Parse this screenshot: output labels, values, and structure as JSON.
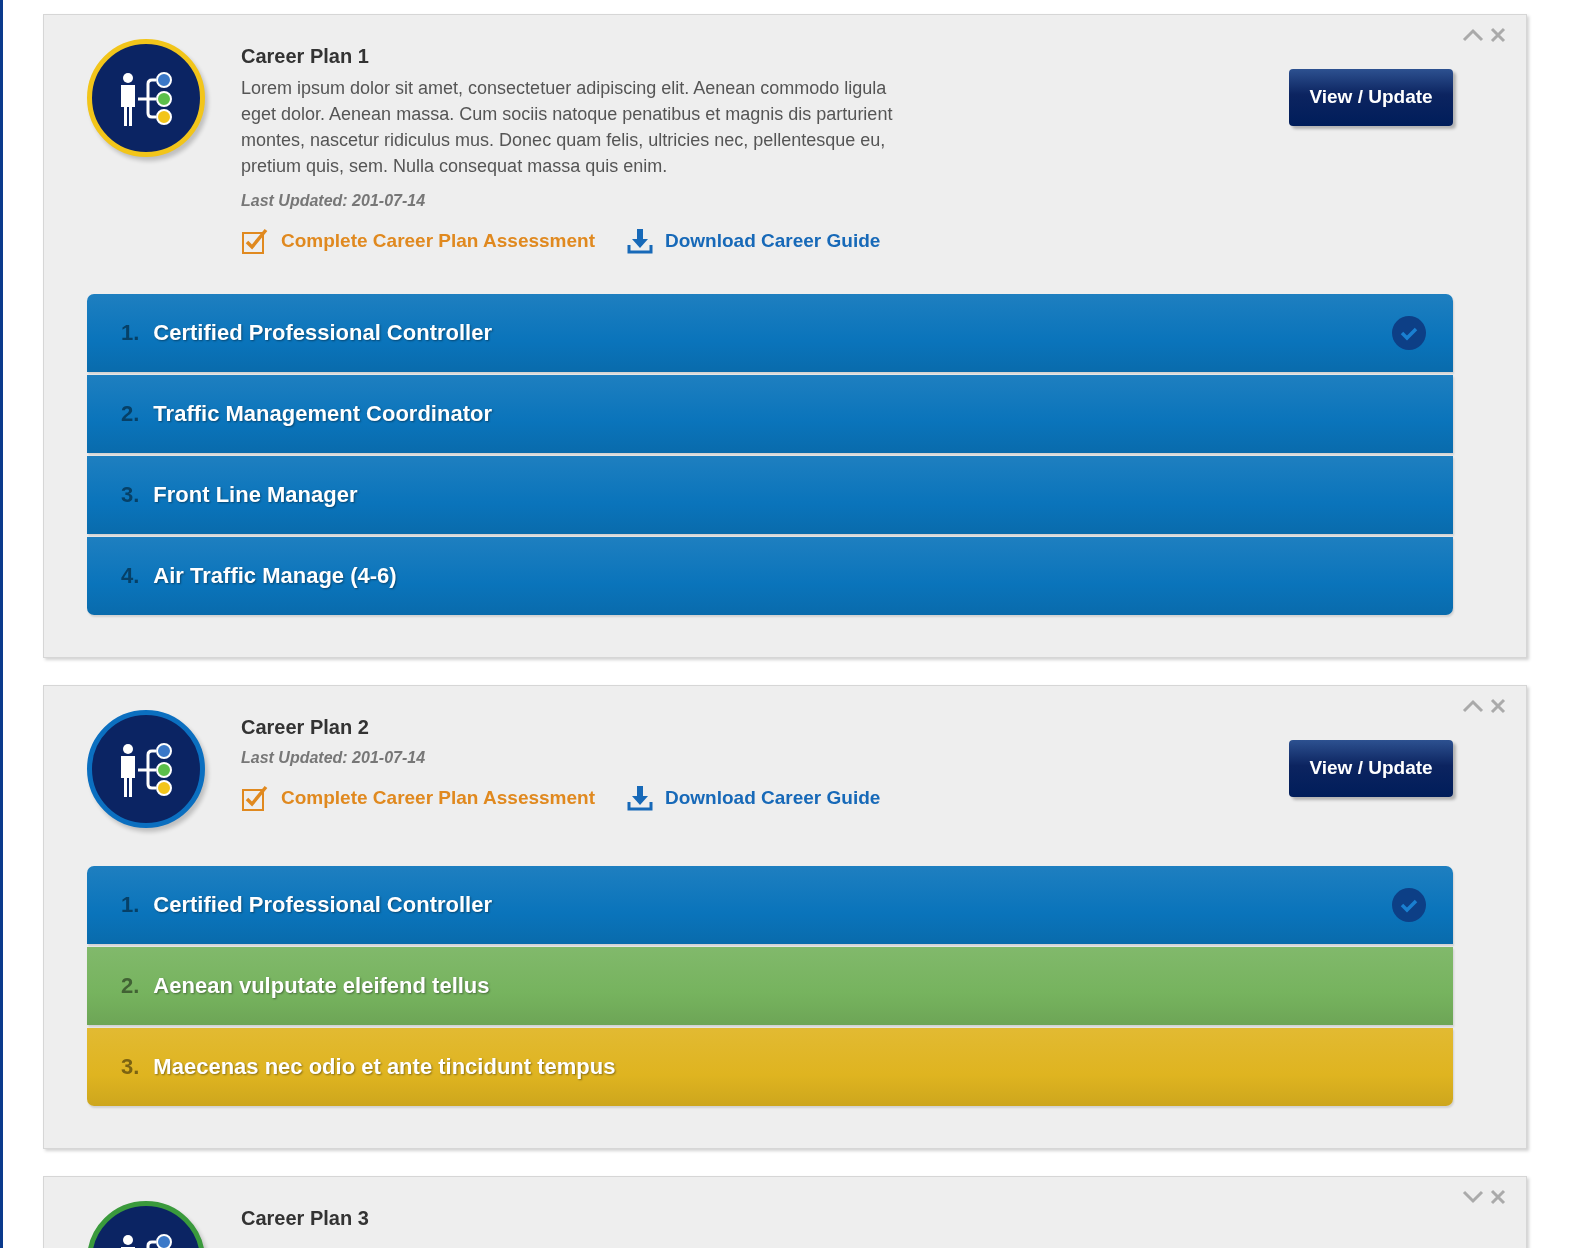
{
  "plans": [
    {
      "title": "Career Plan 1",
      "color": "#f2c51a",
      "expanded": true,
      "description": "Lorem ipsum dolor sit amet, consectetuer adipiscing elit. Aenean commodo ligula eget dolor. Aenean massa. Cum sociis natoque penatibus et magnis dis parturient montes, nascetur ridiculus mus. Donec quam felis, ultricies nec, pellentesque eu, pretium quis, sem. Nulla consequat massa quis enim.",
      "last_updated": "Last Updated: 201-07-14",
      "assessment_link": "Complete Career Plan Assessment",
      "guide_link": "Download Career Guide",
      "button": "View / Update",
      "steps": [
        {
          "number": "1.",
          "label": "Certified Professional Controller",
          "color": "#0a74bb",
          "completed": true
        },
        {
          "number": "2.",
          "label": "Traffic Management Coordinator",
          "color": "#0a74bb",
          "completed": false
        },
        {
          "number": "3.",
          "label": "Front Line Manager",
          "color": "#0a74bb",
          "completed": false
        },
        {
          "number": "4.",
          "label": "Air Traffic Manage (4-6)",
          "color": "#0a74bb",
          "completed": false
        }
      ]
    },
    {
      "title": "Career Plan 2",
      "color": "#0b6fc0",
      "expanded": true,
      "last_updated": "Last Updated: 201-07-14",
      "assessment_link": "Complete Career Plan Assessment",
      "guide_link": "Download Career Guide",
      "button": "View / Update",
      "steps": [
        {
          "number": "1.",
          "label": "Certified Professional Controller",
          "color": "#0a74bb",
          "completed": true
        },
        {
          "number": "2.",
          "label": "Aenean vulputate eleifend tellus",
          "color": "#76b35e",
          "completed": false
        },
        {
          "number": "3.",
          "label": "Maecenas nec odio et ante tincidunt tempus",
          "color": "#dfb420",
          "completed": false
        }
      ]
    },
    {
      "title": "Career Plan 3",
      "color": "#3a9a3c",
      "expanded": false
    }
  ]
}
